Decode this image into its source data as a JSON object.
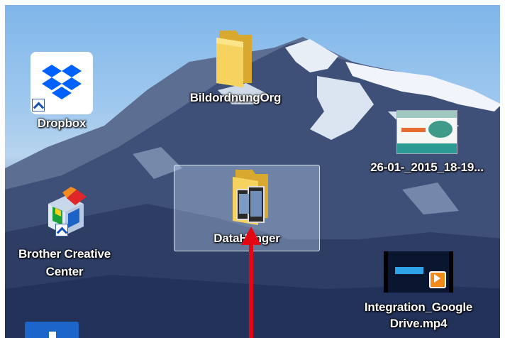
{
  "desktop": {
    "icons": [
      {
        "label": "Dropbox",
        "type": "shortcut"
      },
      {
        "label": "BildordnungOrg",
        "type": "folder"
      },
      {
        "label": "26-01-_2015_18-19...",
        "type": "image"
      },
      {
        "label": "DataHanger",
        "type": "folder",
        "selected": true
      },
      {
        "label": "Brother Creative Center",
        "line1": "Brother Creative",
        "line2": "Center",
        "type": "shortcut"
      },
      {
        "label": "Integration_Google Drive.mp4",
        "line1": "Integration_Google",
        "line2": "Drive.mp4",
        "type": "video"
      }
    ]
  },
  "annotation": {
    "arrow_color": "#e30613"
  },
  "colors": {
    "folder": "#f4cf55",
    "selection": "#c8e1ff"
  }
}
